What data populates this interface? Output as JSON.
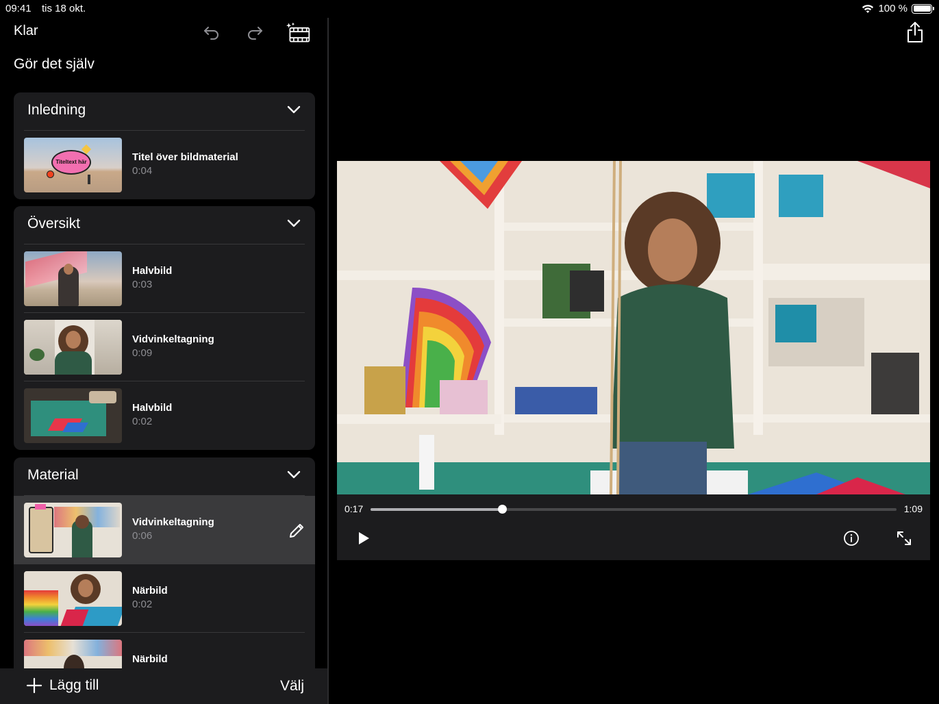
{
  "status": {
    "time": "09:41",
    "date": "tis 18 okt.",
    "battery": "100 %"
  },
  "toolbar": {
    "done": "Klar",
    "undo_icon": "undo-icon",
    "redo_icon": "redo-icon",
    "magic_icon": "magic-movie-icon"
  },
  "project": {
    "title": "Gör det själv"
  },
  "sections": [
    {
      "title": "Inledning",
      "clips": [
        {
          "name": "Titel över bildmaterial",
          "duration": "0:04",
          "thumb_text": "Titeltext här"
        }
      ]
    },
    {
      "title": "Översikt",
      "clips": [
        {
          "name": "Halvbild",
          "duration": "0:03"
        },
        {
          "name": "Vidvinkeltagning",
          "duration": "0:09"
        },
        {
          "name": "Halvbild",
          "duration": "0:02"
        }
      ]
    },
    {
      "title": "Material",
      "clips": [
        {
          "name": "Vidvinkeltagning",
          "duration": "0:06",
          "selected": true
        },
        {
          "name": "Närbild",
          "duration": "0:02"
        },
        {
          "name": "Närbild",
          "duration": ""
        }
      ]
    }
  ],
  "bottom": {
    "add": "Lägg till",
    "select": "Välj"
  },
  "player": {
    "current": "0:17",
    "total": "1:09",
    "progress": 0.25
  },
  "colors": {
    "panel": "#1c1c1e",
    "selected": "#3a3a3c",
    "secondary_text": "#8e8e93"
  }
}
